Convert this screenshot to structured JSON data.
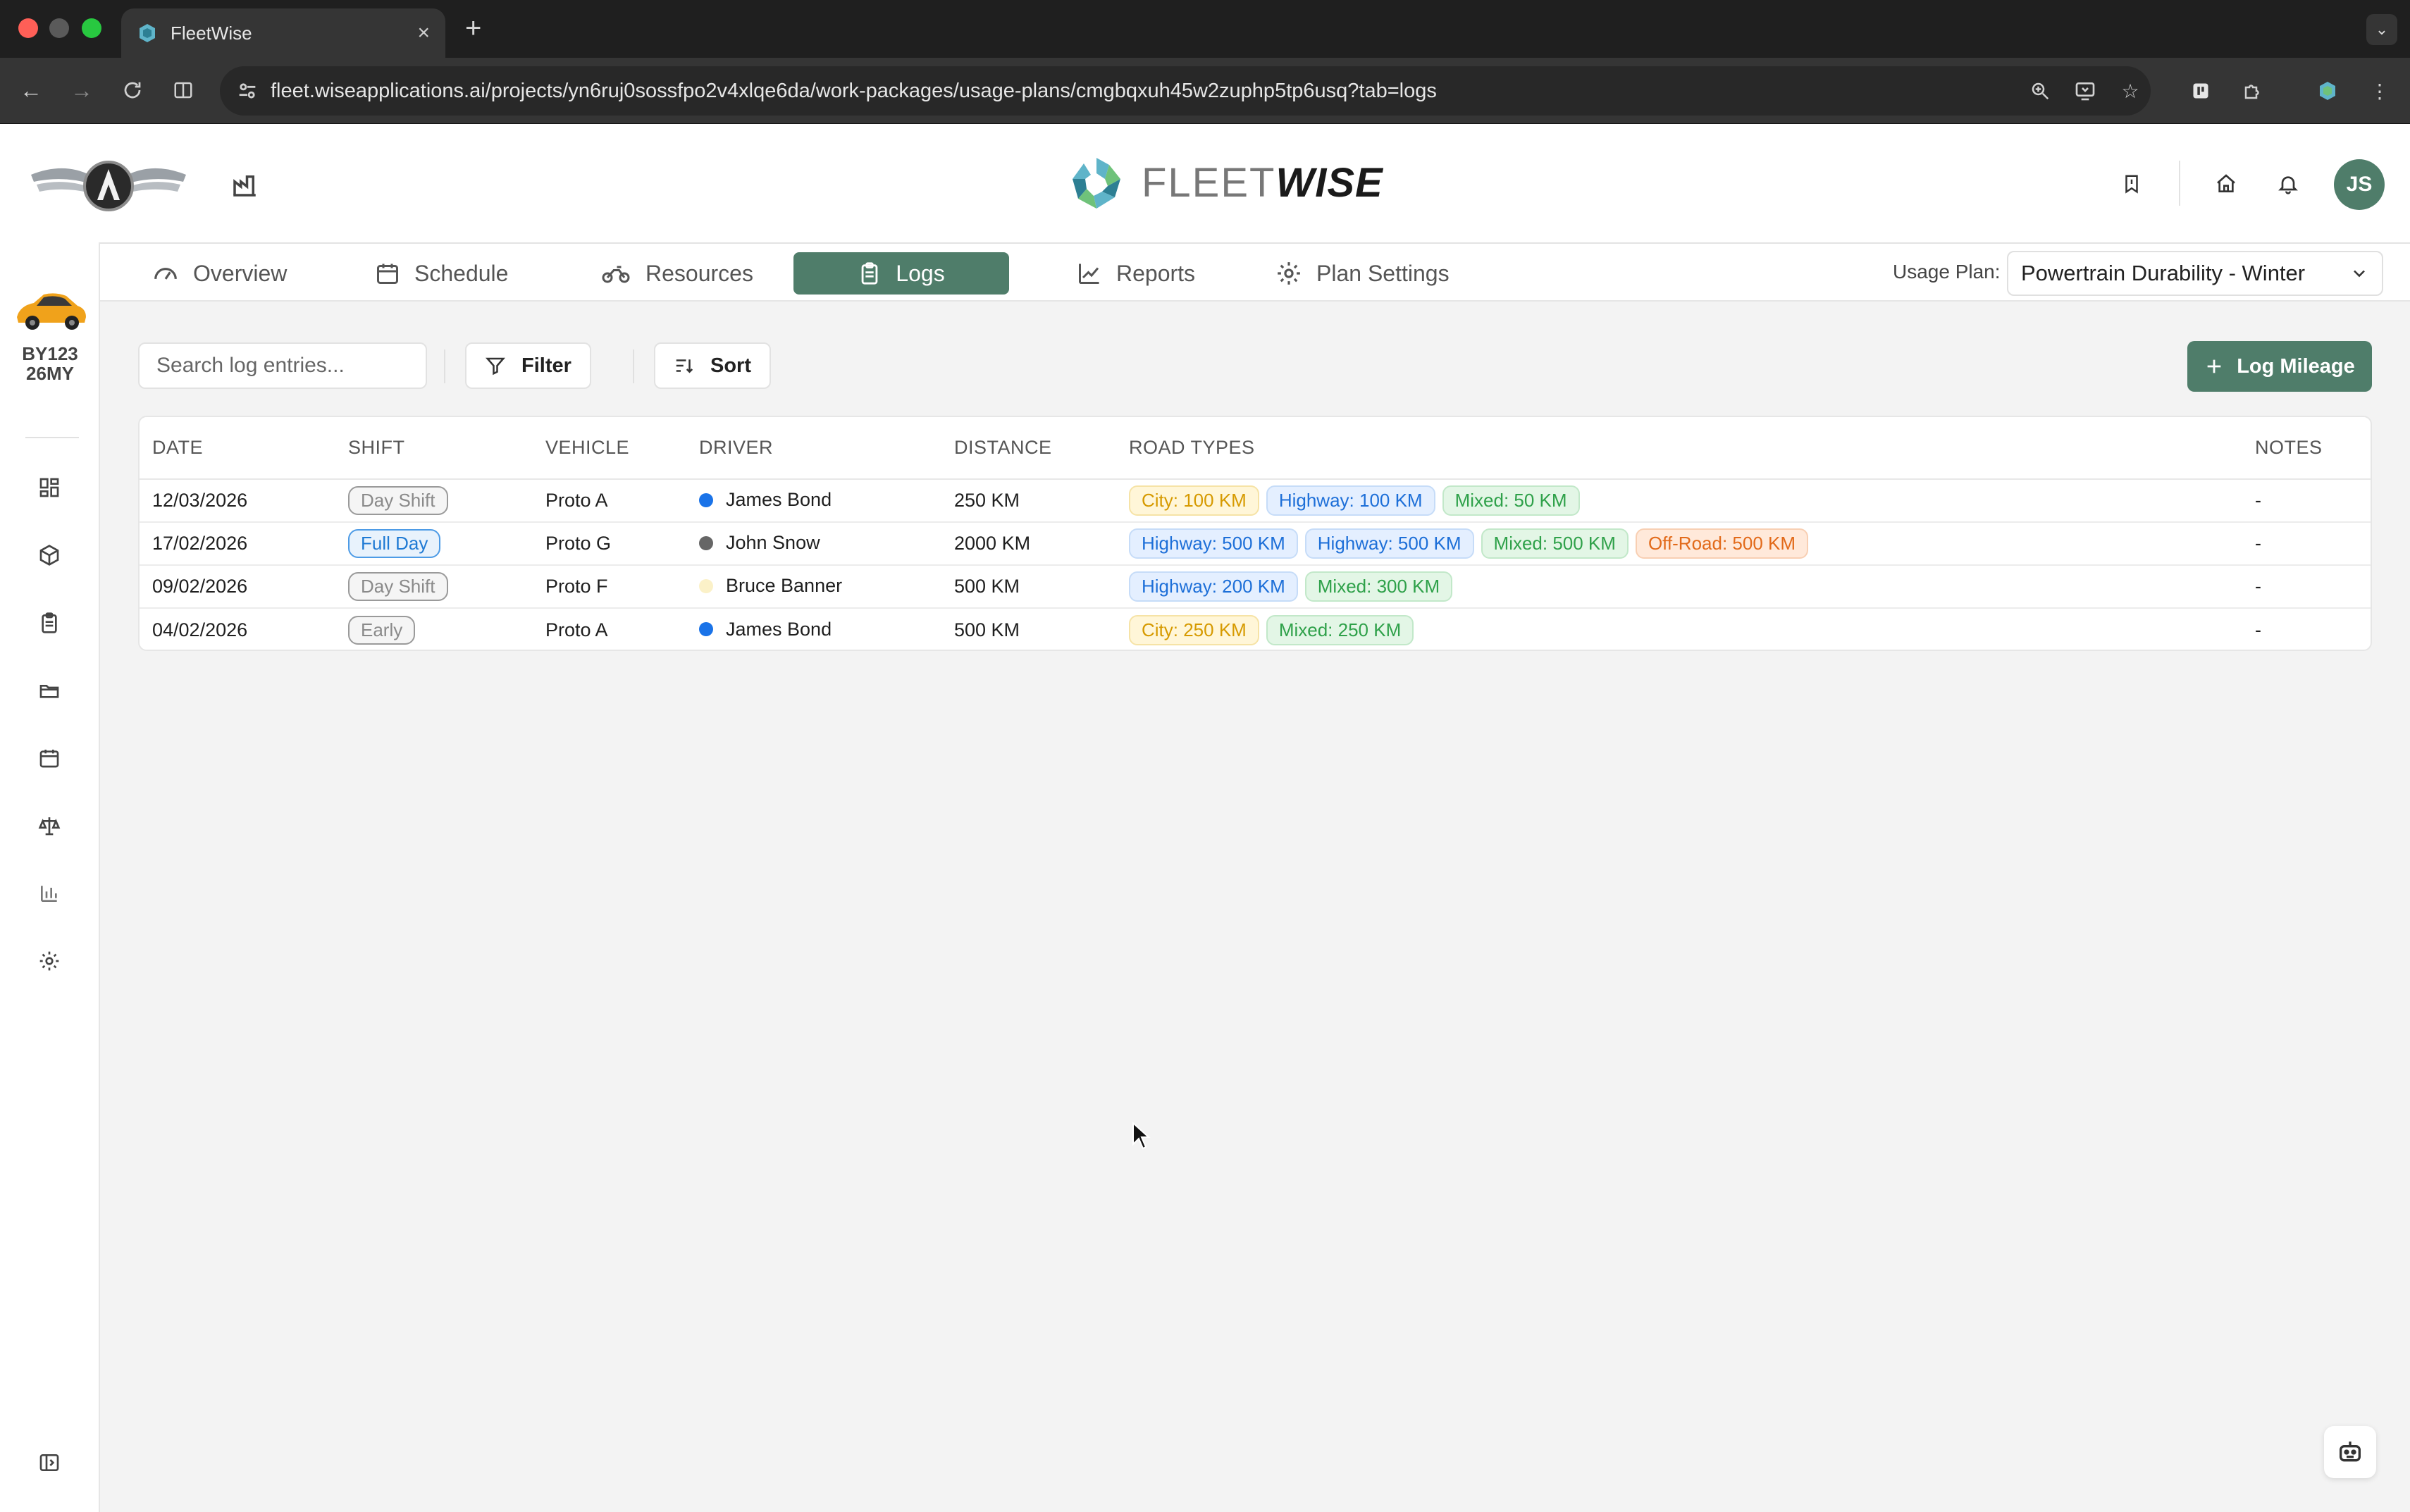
{
  "browser": {
    "tab_title": "FleetWise",
    "url": "fleet.wiseapplications.ai/projects/yn6ruj0sossfpo2v4xlqe6da/work-packages/usage-plans/cmgbqxuh45w2zuphp5tp6usq?tab=logs"
  },
  "header": {
    "brand_word_light": "FLEET",
    "brand_word_bold": "WISE",
    "avatar_initials": "JS"
  },
  "sidebar": {
    "vehicle_plate_line1": "BY123",
    "vehicle_plate_line2": "26MY",
    "items": [
      "dashboard-icon",
      "box-icon",
      "clipboard-icon",
      "folder-icon",
      "calendar-icon",
      "scales-icon",
      "bar-chart-icon",
      "gear-icon"
    ]
  },
  "tabs": [
    {
      "label": "Overview",
      "icon": "gauge-icon"
    },
    {
      "label": "Schedule",
      "icon": "calendar-icon"
    },
    {
      "label": "Resources",
      "icon": "motorbike-icon"
    },
    {
      "label": "Logs",
      "icon": "clipboard-icon",
      "active": true
    },
    {
      "label": "Reports",
      "icon": "line-chart-icon"
    },
    {
      "label": "Plan Settings",
      "icon": "gear-icon"
    }
  ],
  "usage_plan": {
    "label": "Usage Plan:",
    "value": "Powertrain Durability - Winter"
  },
  "controls": {
    "search_placeholder": "Search log entries...",
    "filter_label": "Filter",
    "sort_label": "Sort",
    "log_mileage_label": "Log Mileage"
  },
  "table": {
    "columns": [
      "DATE",
      "SHIFT",
      "VEHICLE",
      "DRIVER",
      "DISTANCE",
      "ROAD TYPES",
      "NOTES"
    ],
    "rows": [
      {
        "date": "12/03/2026",
        "shift": "Day Shift",
        "shift_style": "neutral",
        "vehicle": "Proto A",
        "driver": "James Bond",
        "driver_color": "#1a73e8",
        "distance": "250 KM",
        "roads": [
          {
            "text": "City: 100 KM",
            "type": "city"
          },
          {
            "text": "Highway: 100 KM",
            "type": "highway"
          },
          {
            "text": "Mixed: 50 KM",
            "type": "mixed"
          }
        ],
        "notes": "-"
      },
      {
        "date": "17/02/2026",
        "shift": "Full Day",
        "shift_style": "full",
        "vehicle": "Proto G",
        "driver": "John Snow",
        "driver_color": "#666666",
        "distance": "2000 KM",
        "roads": [
          {
            "text": "Highway: 500 KM",
            "type": "highway"
          },
          {
            "text": "Highway: 500 KM",
            "type": "highway"
          },
          {
            "text": "Mixed: 500 KM",
            "type": "mixed"
          },
          {
            "text": "Off-Road: 500 KM",
            "type": "offroad"
          }
        ],
        "notes": "-"
      },
      {
        "date": "09/02/2026",
        "shift": "Day Shift",
        "shift_style": "neutral",
        "vehicle": "Proto F",
        "driver": "Bruce Banner",
        "driver_color": "#fbf1c8",
        "distance": "500 KM",
        "roads": [
          {
            "text": "Highway: 200 KM",
            "type": "highway"
          },
          {
            "text": "Mixed: 300 KM",
            "type": "mixed"
          }
        ],
        "notes": "-"
      },
      {
        "date": "04/02/2026",
        "shift": "Early",
        "shift_style": "neutral",
        "vehicle": "Proto A",
        "driver": "James Bond",
        "driver_color": "#1a73e8",
        "distance": "500 KM",
        "roads": [
          {
            "text": "City: 250 KM",
            "type": "city"
          },
          {
            "text": "Mixed: 250 KM",
            "type": "mixed"
          }
        ],
        "notes": "-"
      }
    ]
  },
  "colors": {
    "accent": "#4f7d6a",
    "chrome_dark": "#1f1f1f"
  }
}
